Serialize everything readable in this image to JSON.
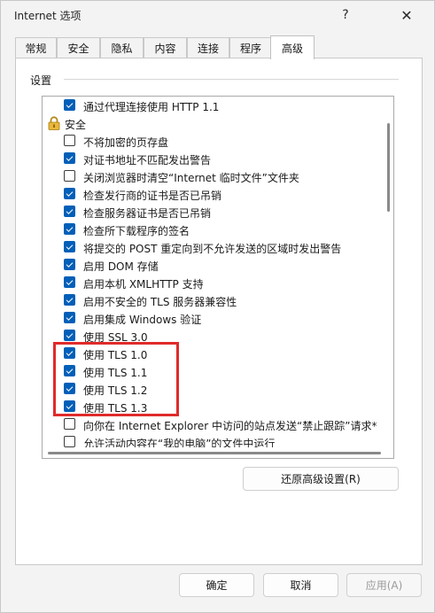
{
  "window": {
    "title": "Internet 选项",
    "help_glyph": "?",
    "close_glyph": "✕"
  },
  "tabs": [
    {
      "label": "常规"
    },
    {
      "label": "安全"
    },
    {
      "label": "隐私"
    },
    {
      "label": "内容"
    },
    {
      "label": "连接"
    },
    {
      "label": "程序"
    },
    {
      "label": "高级",
      "active": true
    }
  ],
  "settings": {
    "group_label": "设置",
    "items": [
      {
        "kind": "option",
        "label": "通过代理连接使用 HTTP 1.1",
        "checked": true
      },
      {
        "kind": "category",
        "label": "安全",
        "icon": "lock-icon"
      },
      {
        "kind": "option",
        "label": "不将加密的页存盘",
        "checked": false
      },
      {
        "kind": "option",
        "label": "对证书地址不匹配发出警告",
        "checked": true
      },
      {
        "kind": "option",
        "label": "关闭浏览器时清空“Internet 临时文件”文件夹",
        "checked": false
      },
      {
        "kind": "option",
        "label": "检查发行商的证书是否已吊销",
        "checked": true
      },
      {
        "kind": "option",
        "label": "检查服务器证书是否已吊销",
        "checked": true
      },
      {
        "kind": "option",
        "label": "检查所下载程序的签名",
        "checked": true
      },
      {
        "kind": "option",
        "label": "将提交的 POST 重定向到不允许发送的区域时发出警告",
        "checked": true
      },
      {
        "kind": "option",
        "label": "启用 DOM 存储",
        "checked": true
      },
      {
        "kind": "option",
        "label": "启用本机 XMLHTTP 支持",
        "checked": true
      },
      {
        "kind": "option",
        "label": "启用不安全的 TLS 服务器兼容性",
        "checked": true
      },
      {
        "kind": "option",
        "label": "启用集成 Windows 验证",
        "checked": true
      },
      {
        "kind": "option",
        "label": "使用 SSL 3.0",
        "checked": true
      },
      {
        "kind": "option",
        "label": "使用 TLS 1.0",
        "checked": true
      },
      {
        "kind": "option",
        "label": "使用 TLS 1.1",
        "checked": true
      },
      {
        "kind": "option",
        "label": "使用 TLS 1.2",
        "checked": true
      },
      {
        "kind": "option",
        "label": "使用 TLS 1.3",
        "checked": true
      },
      {
        "kind": "option",
        "label": "向你在 Internet Explorer 中访问的站点发送“禁止跟踪”请求*",
        "checked": false
      },
      {
        "kind": "option",
        "label": "允许活动内容在“我的电脑”的文件中运行",
        "checked": false
      }
    ]
  },
  "buttons": {
    "restore_advanced": "还原高级设置(R)",
    "ok": "确定",
    "cancel": "取消",
    "apply": "应用(A)"
  },
  "colors": {
    "accent": "#005fb8",
    "highlight": "#e02a2a"
  }
}
